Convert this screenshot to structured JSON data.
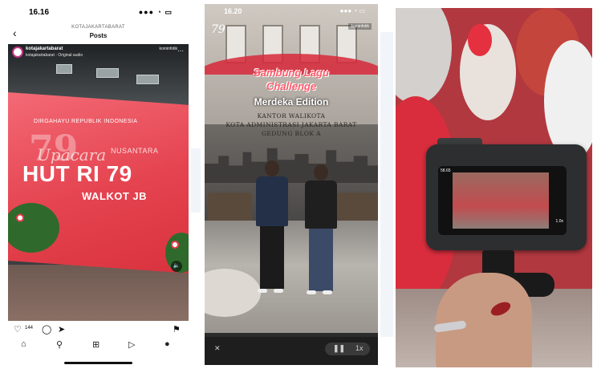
{
  "panel1": {
    "status_time": "16.16",
    "status_icons": "●●● ◔ ▭",
    "nav": {
      "account": "KOTAJAKARTABARAT",
      "title": "Posts"
    },
    "post": {
      "username": "kotajakartabarat",
      "audio": "kotajakartabarat · Original audio",
      "tag": "kominfotik"
    },
    "banner": {
      "heading": "DIRGAHAYU REPUBLIK INDONESIA",
      "script": "Upacara",
      "big_number": "79",
      "side_text": "NUSANTARA",
      "title": "HUT RI 79",
      "subtitle": "WALKOT JB"
    },
    "likes": "144"
  },
  "panel2": {
    "status_time": "16.20",
    "status_icons": "●●● ◔ ▭",
    "overlay_line1": "Sambung Lagu",
    "overlay_line2": "Challenge",
    "overlay_line3": "Merdeka Edition",
    "wall_line1": "KANTOR WALIKOTA",
    "wall_line2": "KOTA ADMINISTRASI JAKARTA BARAT",
    "wall_line3": "GEDUNG BLOK A",
    "sticker": "kominfotik",
    "speed": "1x"
  },
  "panel3": {
    "screen_time": "58.65",
    "screen_speed": "1.0x"
  },
  "colors": {
    "accent_red": "#e4434f",
    "instagram_ring": "#c13584"
  },
  "icons": [
    "back-arrow-icon",
    "heart-icon",
    "comment-icon",
    "share-icon",
    "bookmark-icon",
    "home-icon",
    "search-icon",
    "add-icon",
    "reels-icon",
    "profile-icon",
    "close-icon",
    "pause-icon",
    "mute-icon"
  ]
}
